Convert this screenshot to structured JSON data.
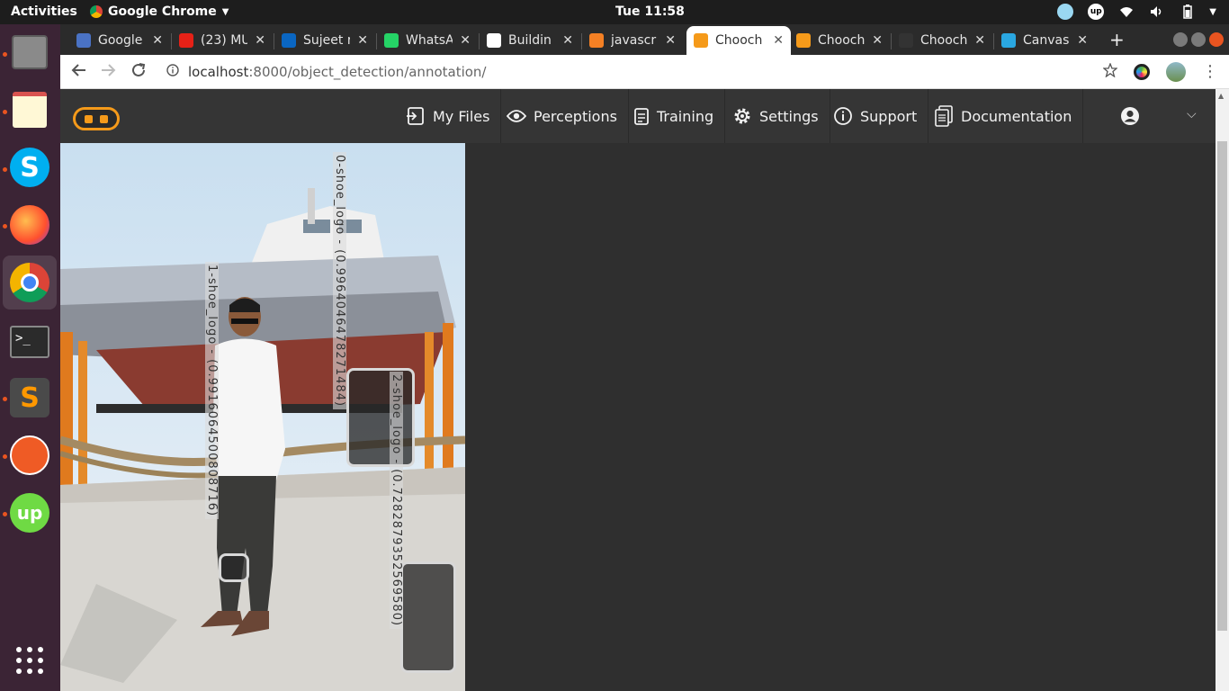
{
  "os": {
    "activities": "Activities",
    "app_menu": "Google Chrome",
    "clock": "Tue 11:58"
  },
  "browser": {
    "tabs": [
      {
        "title": "Google",
        "favicon_color": "#4a72c4"
      },
      {
        "title": "(23) MU",
        "favicon_color": "#e62117"
      },
      {
        "title": "Sujeet r",
        "favicon_color": "#0a66c2"
      },
      {
        "title": "WhatsA",
        "favicon_color": "#25d366"
      },
      {
        "title": "Buildin",
        "favicon_color": "#ffffff"
      },
      {
        "title": "javascr",
        "favicon_color": "#f48024"
      },
      {
        "title": "Chooch",
        "favicon_color": "#f59a1a",
        "active": true
      },
      {
        "title": "Chooch",
        "favicon_color": "#f59a1a"
      },
      {
        "title": "Chooch",
        "favicon_color": "#333333"
      },
      {
        "title": "Canvas",
        "favicon_color": "#2aa7e1"
      }
    ],
    "tab_close": "✕",
    "new_tab": "+",
    "url_host": "localhost",
    "url_rest": ":8000/object_detection/annotation/"
  },
  "app": {
    "accent": "#f59a1a",
    "nav": [
      {
        "label": "My Files",
        "icon": "file-import-icon"
      },
      {
        "label": "Perceptions",
        "icon": "eye-icon"
      },
      {
        "label": "Training",
        "icon": "clipboard-icon"
      },
      {
        "label": "Settings",
        "icon": "gear-icon"
      },
      {
        "label": "Support",
        "icon": "info-icon"
      },
      {
        "label": "Documentation",
        "icon": "documents-icon"
      }
    ],
    "chevron": "⌵"
  },
  "annotations": [
    {
      "label": "0-shoe_logo - (0.9964046478271484)"
    },
    {
      "label": "1-shoe_logo - (0.9916064500808716)"
    },
    {
      "label": "2-shoe_logo - (0.7282879352569580)"
    }
  ]
}
